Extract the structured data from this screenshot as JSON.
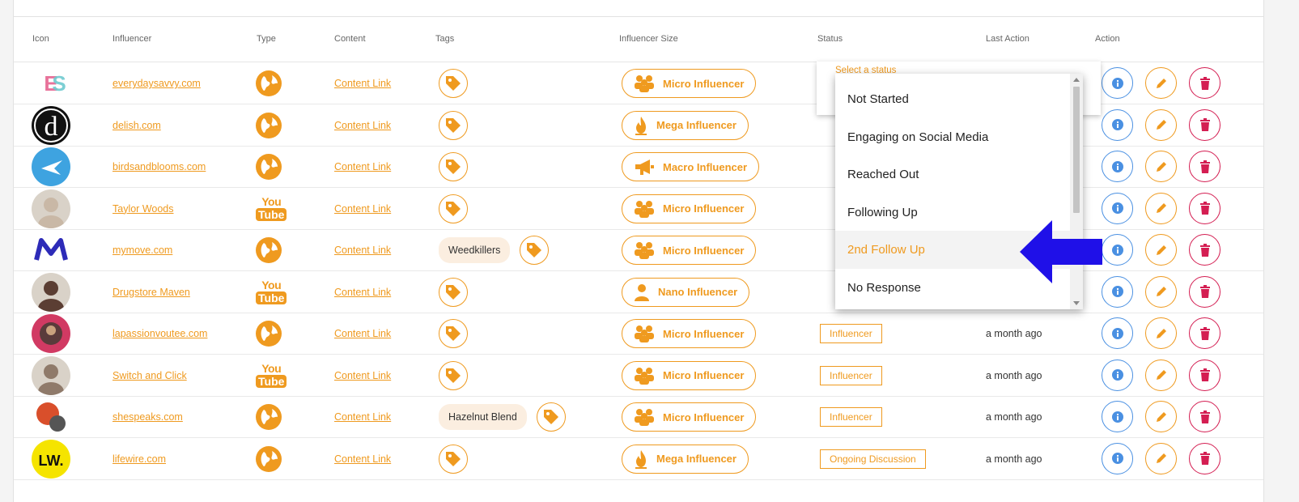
{
  "table": {
    "headers": [
      "Icon",
      "Influencer",
      "Type",
      "Content",
      "Tags",
      "Influencer Size",
      "Status",
      "Last Action",
      "Action"
    ],
    "rows": [
      {
        "avatar": "es-logo",
        "influencer": "everydaysavvy.com",
        "type": "globe",
        "content": "Content Link",
        "tag_chip": "",
        "size": "Micro Influencer",
        "size_icon": "group-icon",
        "status": "",
        "last_action": ""
      },
      {
        "avatar": "delish-logo",
        "influencer": "delish.com",
        "type": "globe",
        "content": "Content Link",
        "tag_chip": "",
        "size": "Mega Influencer",
        "size_icon": "fire-icon",
        "status": "",
        "last_action": ""
      },
      {
        "avatar": "birds-logo",
        "influencer": "birdsandblooms.com",
        "type": "globe",
        "content": "Content Link",
        "tag_chip": "",
        "size": "Macro Influencer",
        "size_icon": "megaphone-icon",
        "status": "",
        "last_action": ""
      },
      {
        "avatar": "photo",
        "influencer": "Taylor Woods",
        "type": "youtube",
        "content": "Content Link",
        "tag_chip": "",
        "size": "Micro Influencer",
        "size_icon": "group-icon",
        "status": "",
        "last_action": ""
      },
      {
        "avatar": "mymove-logo",
        "influencer": "mymove.com",
        "type": "globe",
        "content": "Content Link",
        "tag_chip": "Weedkillers",
        "size": "Micro Influencer",
        "size_icon": "group-icon",
        "status": "",
        "last_action": ""
      },
      {
        "avatar": "photo",
        "influencer": "Drugstore Maven",
        "type": "youtube",
        "content": "Content Link",
        "tag_chip": "",
        "size": "Nano Influencer",
        "size_icon": "person-icon",
        "status": "",
        "last_action": ""
      },
      {
        "avatar": "lapassion-logo",
        "influencer": "lapassionvoutee.com",
        "type": "globe",
        "content": "Content Link",
        "tag_chip": "",
        "size": "Micro Influencer",
        "size_icon": "group-icon",
        "status": "Influencer",
        "last_action": "a month ago"
      },
      {
        "avatar": "photo",
        "influencer": "Switch and Click",
        "type": "youtube",
        "content": "Content Link",
        "tag_chip": "",
        "size": "Micro Influencer",
        "size_icon": "group-icon",
        "status": "Influencer",
        "last_action": "a month ago"
      },
      {
        "avatar": "shespeaks-logo",
        "influencer": "shespeaks.com",
        "type": "globe",
        "content": "Content Link",
        "tag_chip": "Hazelnut Blend",
        "size": "Micro Influencer",
        "size_icon": "group-icon",
        "status": "Influencer",
        "last_action": "a month ago"
      },
      {
        "avatar": "lw-logo",
        "influencer": "lifewire.com",
        "type": "globe",
        "content": "Content Link",
        "tag_chip": "",
        "size": "Mega Influencer",
        "size_icon": "fire-icon",
        "status": "Ongoing Discussion",
        "last_action": "a month ago"
      }
    ]
  },
  "type_labels": {
    "youtube_top": "You",
    "youtube_bottom": "Tube"
  },
  "status_select": {
    "label": "Select a status",
    "options": [
      "Not Started",
      "Engaging on Social Media",
      "Reached Out",
      "Following Up",
      "2nd Follow Up",
      "No Response"
    ],
    "highlighted": "2nd Follow Up"
  },
  "colors": {
    "accent": "#ef9a1f",
    "info": "#4a90e2",
    "delete": "#d41e52",
    "annotation_arrow": "#1f10e8"
  }
}
